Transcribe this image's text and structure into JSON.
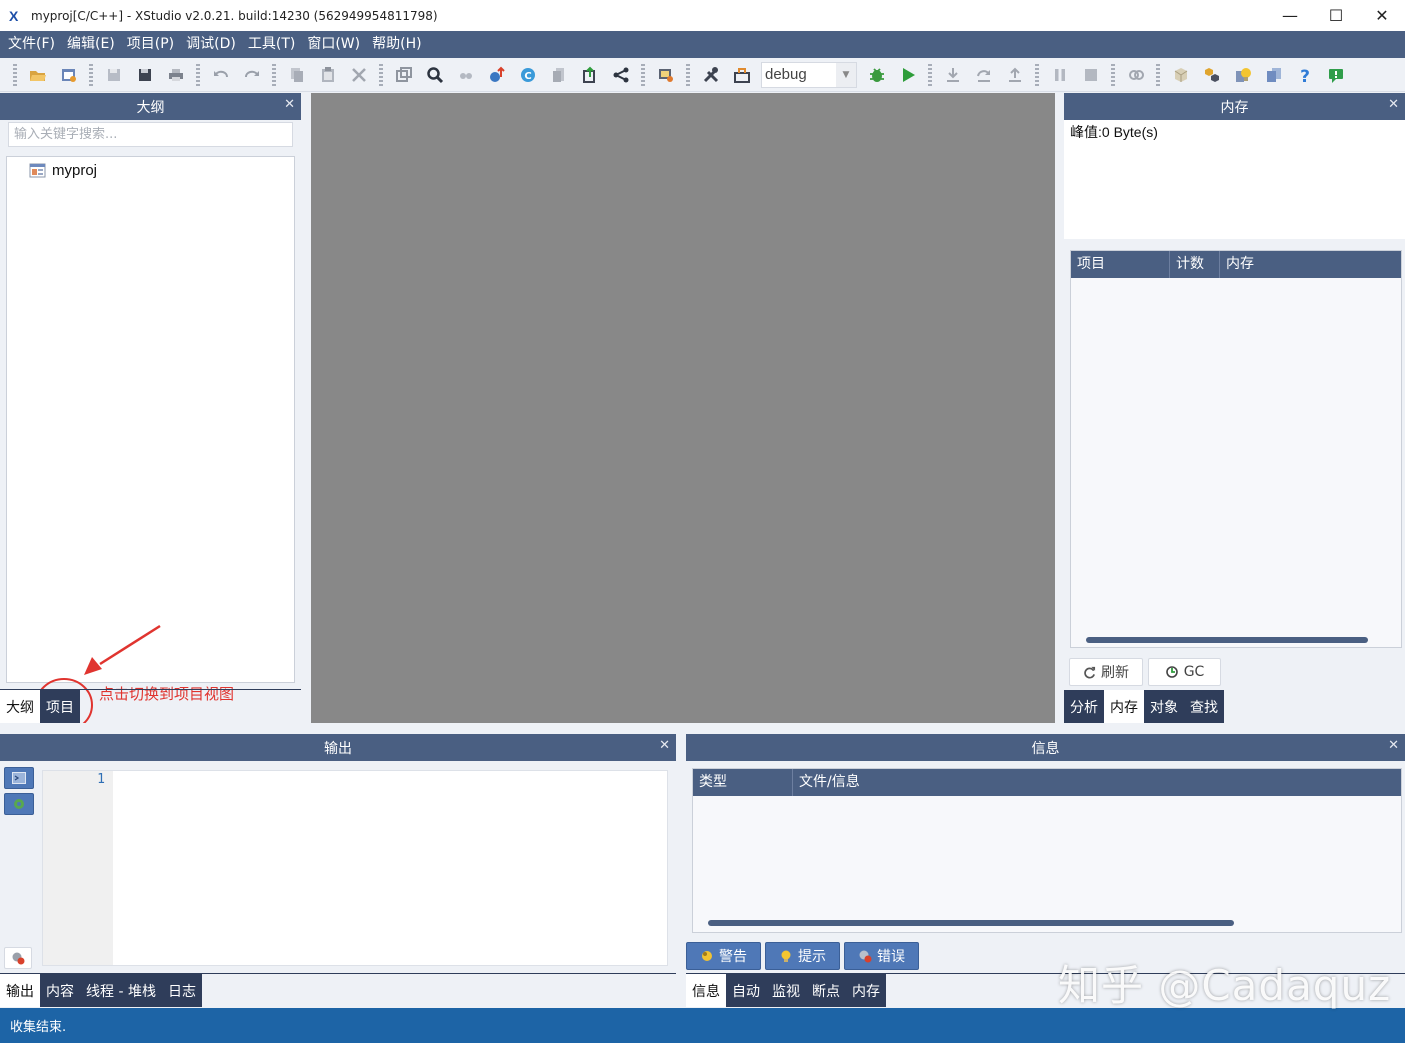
{
  "window": {
    "title": "myproj[C/C++] - XStudio v2.0.21. build:14230 (562949954811798)",
    "logo": "X",
    "minimize": "—",
    "maximize": "☐",
    "close": "✕"
  },
  "menu": [
    "文件(F)",
    "编辑(E)",
    "项目(P)",
    "调试(D)",
    "工具(T)",
    "窗口(W)",
    "帮助(H)"
  ],
  "toolbar": {
    "config_value": "debug",
    "config_arrow": "▼"
  },
  "outline_panel": {
    "title": "大纲",
    "close": "✕",
    "search_placeholder": "输入关键字搜索...",
    "tree": [
      {
        "label": "myproj",
        "icon": "project-icon"
      }
    ],
    "annotation": "点击切换到项目视图",
    "tabs": [
      {
        "label": "大纲",
        "active": true
      },
      {
        "label": "项目",
        "active": false
      }
    ]
  },
  "memory_panel": {
    "title": "内存",
    "close": "✕",
    "peak": "峰值:0 Byte(s)",
    "columns": [
      "项目",
      "计数",
      "内存"
    ],
    "refresh_label": "刷新",
    "gc_label": "GC",
    "tabs": [
      {
        "label": "分析",
        "active": false
      },
      {
        "label": "内存",
        "active": true
      },
      {
        "label": "对象",
        "active": false
      },
      {
        "label": "查找",
        "active": false
      }
    ]
  },
  "output_panel": {
    "title": "输出",
    "close": "✕",
    "line_number": "1",
    "tabs": [
      {
        "label": "输出",
        "active": true
      },
      {
        "label": "内容",
        "active": false
      },
      {
        "label": "线程 - 堆栈",
        "active": false
      },
      {
        "label": "日志",
        "active": false
      }
    ]
  },
  "info_panel": {
    "title": "信息",
    "close": "✕",
    "columns": [
      "类型",
      "文件/信息"
    ],
    "buttons": [
      "警告",
      "提示",
      "错误"
    ],
    "tabs": [
      {
        "label": "信息",
        "active": true
      },
      {
        "label": "自动",
        "active": false
      },
      {
        "label": "监视",
        "active": false
      },
      {
        "label": "断点",
        "active": false
      },
      {
        "label": "内存",
        "active": false
      }
    ]
  },
  "status": {
    "text": "收集结束."
  },
  "watermark": "知乎 @Cadaquz",
  "colors": {
    "header": "#4a5f82",
    "status": "#1d64a6",
    "annotation": "#e0342f",
    "editor_bg": "#888888"
  }
}
